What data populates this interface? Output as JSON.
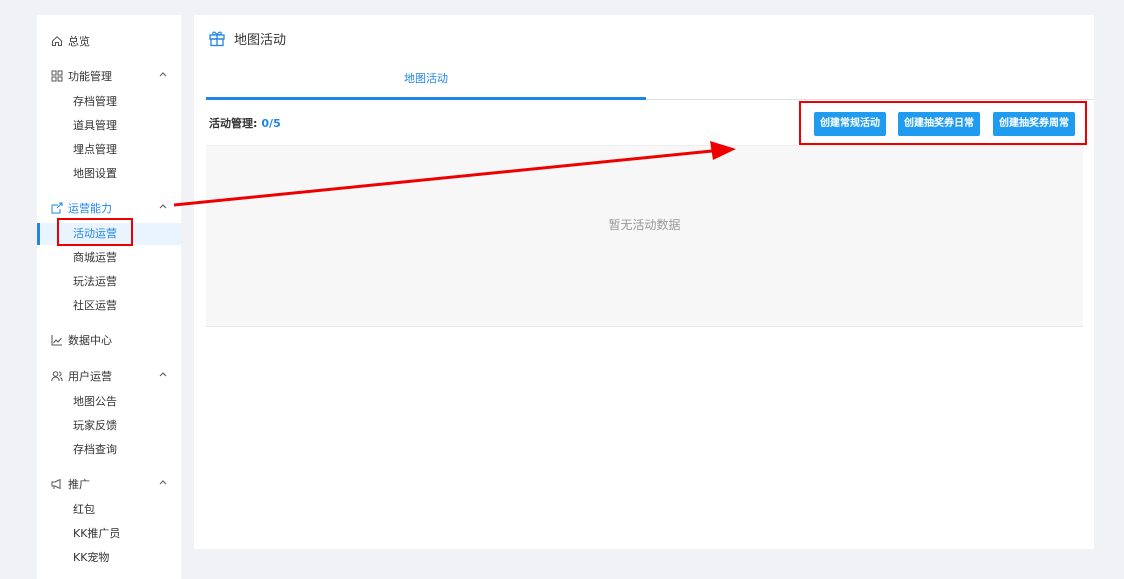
{
  "sidebar": {
    "overview": "总览",
    "groups": [
      {
        "label": "功能管理",
        "icon": "grid-icon",
        "items": [
          "存档管理",
          "道具管理",
          "埋点管理",
          "地图设置"
        ]
      },
      {
        "label": "运营能力",
        "icon": "share-icon",
        "items": [
          "活动运营",
          "商城运营",
          "玩法运营",
          "社区运营"
        ]
      },
      {
        "label": "数据中心",
        "icon": "chart-icon",
        "items": []
      },
      {
        "label": "用户运营",
        "icon": "users-icon",
        "items": [
          "地图公告",
          "玩家反馈",
          "存档查询"
        ]
      },
      {
        "label": "推广",
        "icon": "megaphone-icon",
        "items": [
          "红包",
          "KK推广员",
          "KK宠物"
        ]
      }
    ],
    "active_item": "活动运营"
  },
  "main": {
    "title": "地图活动",
    "tabs": [
      {
        "label": "地图活动",
        "active": true
      }
    ],
    "toolbar": {
      "label": "活动管理:",
      "count": "0/5",
      "buttons": [
        "创建常规活动",
        "创建抽奖券日常",
        "创建抽奖券周常"
      ]
    },
    "empty_text": "暂无活动数据"
  },
  "colors": {
    "accent": "#1f86e8",
    "button": "#1f9bf0",
    "annotation": "#e00000"
  }
}
